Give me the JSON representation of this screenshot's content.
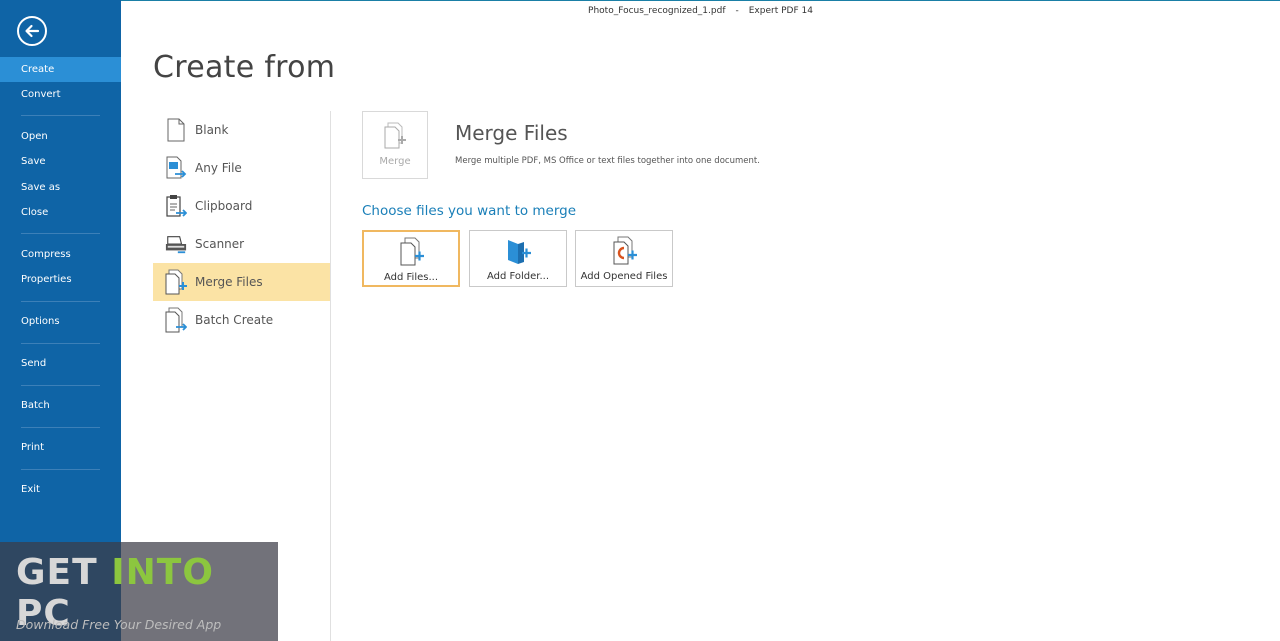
{
  "window": {
    "file_name": "Photo_Focus_recognized_1.pdf",
    "separator": "-",
    "app_name": "Expert PDF 14"
  },
  "sidebar": {
    "items": [
      {
        "label": "Create",
        "active": true
      },
      {
        "label": "Convert"
      },
      {
        "label": "Open"
      },
      {
        "label": "Save"
      },
      {
        "label": "Save as"
      },
      {
        "label": "Close"
      },
      {
        "label": "Compress"
      },
      {
        "label": "Properties"
      },
      {
        "label": "Options"
      },
      {
        "label": "Send"
      },
      {
        "label": "Batch"
      },
      {
        "label": "Print"
      },
      {
        "label": "Exit"
      }
    ]
  },
  "main": {
    "title": "Create from",
    "create_items": [
      {
        "label": "Blank",
        "icon": "blank-page-icon"
      },
      {
        "label": "Any File",
        "icon": "any-file-icon"
      },
      {
        "label": "Clipboard",
        "icon": "clipboard-icon"
      },
      {
        "label": "Scanner",
        "icon": "scanner-icon"
      },
      {
        "label": "Merge Files",
        "icon": "merge-files-icon",
        "selected": true
      },
      {
        "label": "Batch Create",
        "icon": "batch-create-icon"
      }
    ],
    "merge": {
      "tile_label": "Merge",
      "heading": "Merge Files",
      "description": "Merge multiple PDF, MS Office or text files together into one document.",
      "choose_label": "Choose files you want to merge",
      "actions": [
        {
          "label": "Add Files...",
          "icon": "add-files-icon"
        },
        {
          "label": "Add Folder...",
          "icon": "add-folder-icon"
        },
        {
          "label": "Add Opened Files",
          "icon": "add-opened-files-icon"
        }
      ]
    }
  },
  "watermark": {
    "word1": "GET ",
    "word2": "INTO",
    "word3": " PC",
    "tagline": "Download Free Your Desired App"
  },
  "colors": {
    "sidebar_bg": "#0f64a6",
    "sidebar_active": "#2b8fd6",
    "selected_item": "#fbe3a5",
    "accent_text": "#1a7fb8",
    "focus_border": "#f0b860"
  }
}
